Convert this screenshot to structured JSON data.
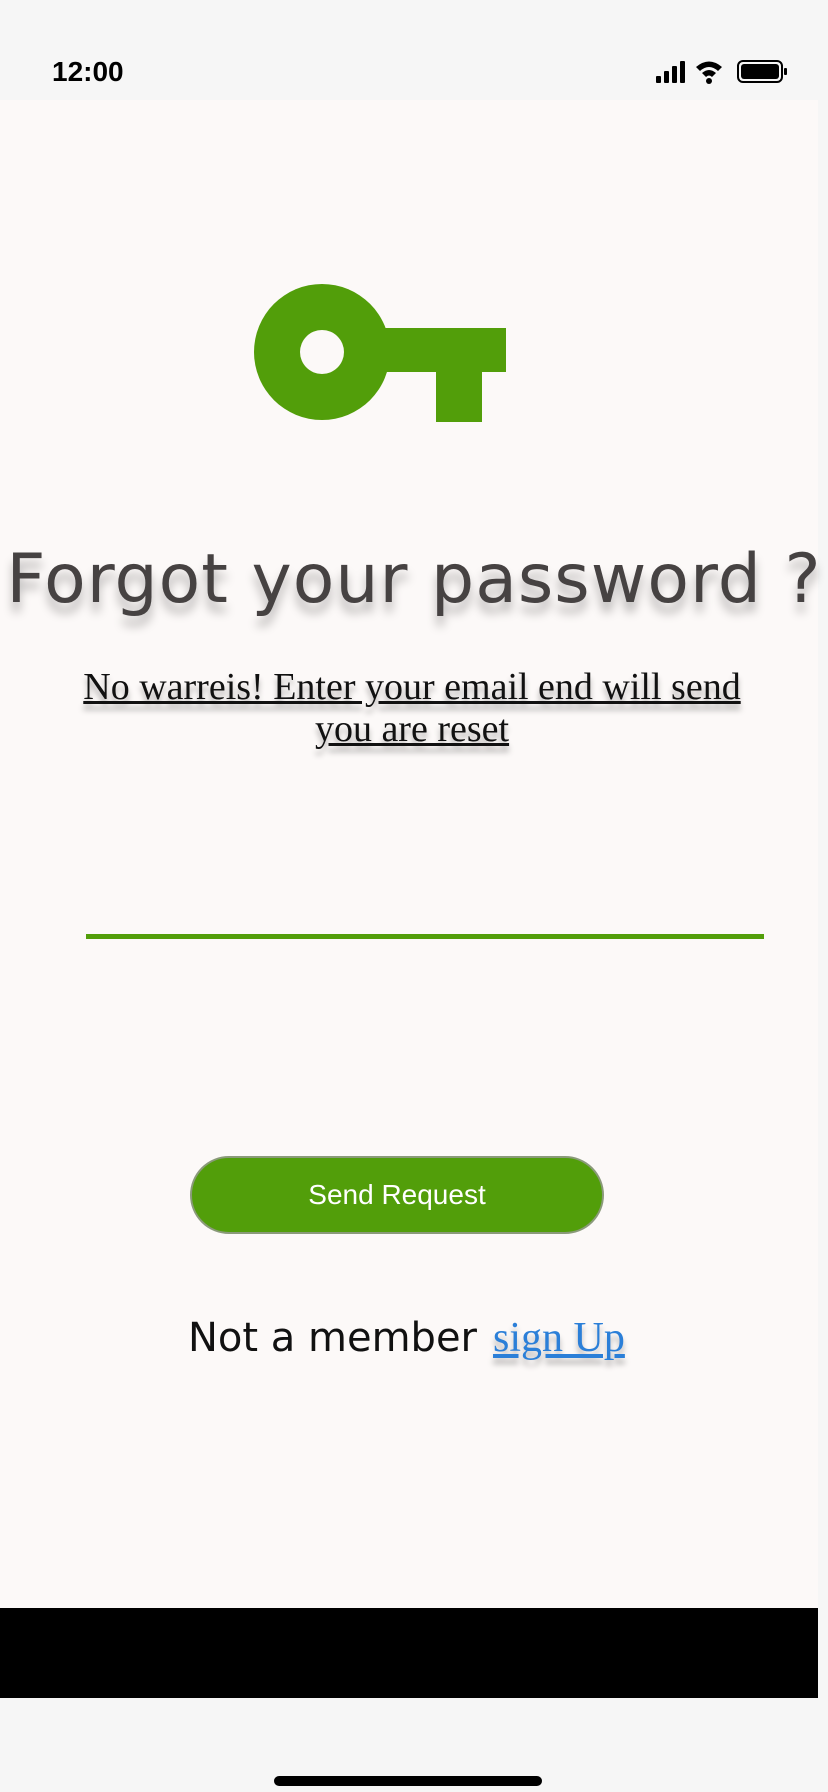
{
  "status_bar": {
    "time": "12:00",
    "icons": [
      "signal-icon",
      "wifi-icon",
      "battery-icon"
    ]
  },
  "header": {
    "icon": "key-icon",
    "title": "Forgot your password ?",
    "subtitle": "No warreis! Enter your email end will send you are reset"
  },
  "form": {
    "email_value": "",
    "email_placeholder": ""
  },
  "actions": {
    "send_label": "Send Request"
  },
  "footer": {
    "prompt": "Not a member",
    "link_label": "sign Up"
  },
  "colors": {
    "accent": "#529e0a",
    "title": "#464242",
    "link": "#2b7fd8",
    "background": "#fcf9f8"
  }
}
